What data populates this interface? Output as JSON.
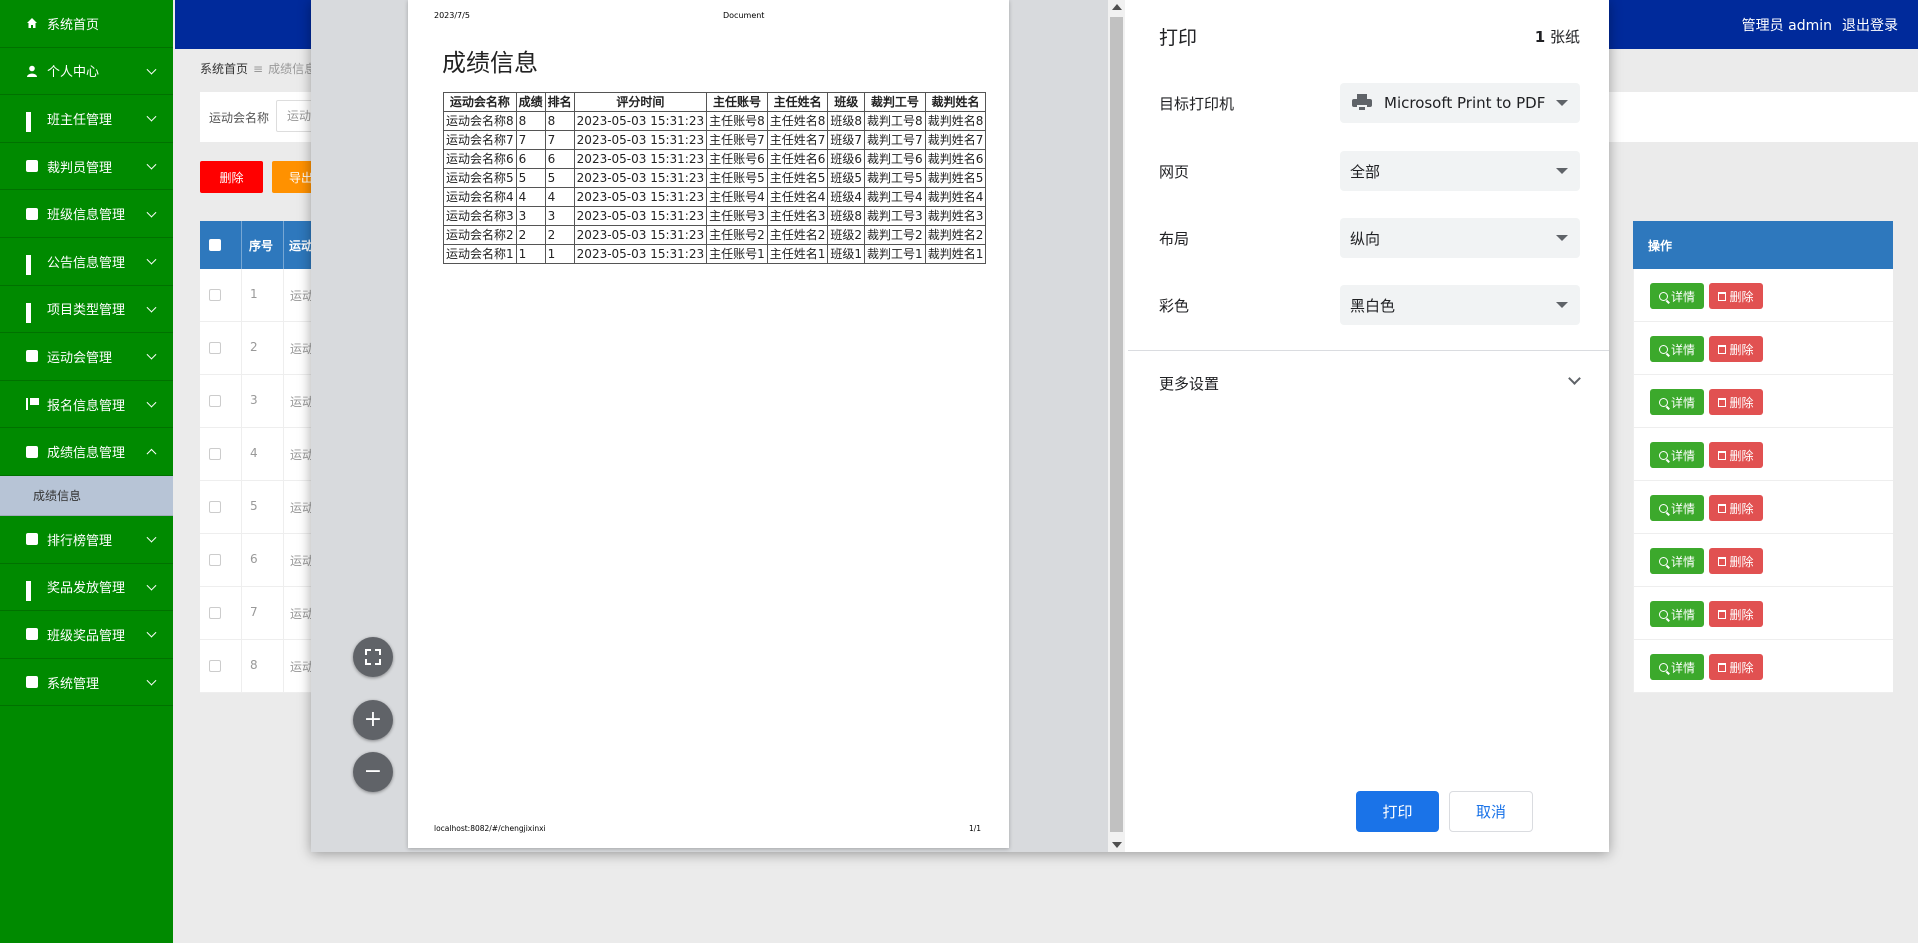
{
  "sidebar": {
    "items": [
      {
        "label": "系统首页",
        "icon": "home-icon",
        "chevron": false
      },
      {
        "label": "个人中心",
        "icon": "user-icon",
        "chevron": true
      },
      {
        "label": "班主任管理",
        "icon": "grid-icon",
        "chevron": true
      },
      {
        "label": "裁判员管理",
        "icon": "chat-icon",
        "chevron": true
      },
      {
        "label": "班级信息管理",
        "icon": "clipboard-icon",
        "chevron": true
      },
      {
        "label": "公告信息管理",
        "icon": "grid-icon",
        "chevron": true
      },
      {
        "label": "项目类型管理",
        "icon": "grid-icon",
        "chevron": true
      },
      {
        "label": "运动会管理",
        "icon": "chat-icon",
        "chevron": true
      },
      {
        "label": "报名信息管理",
        "icon": "flag-icon",
        "chevron": true
      },
      {
        "label": "成绩信息管理",
        "icon": "briefcase-icon",
        "chevron": true,
        "expanded": true
      }
    ],
    "submenu": {
      "label": "成绩信息"
    },
    "items_after": [
      {
        "label": "排行榜管理",
        "icon": "clipboard-icon"
      },
      {
        "label": "奖品发放管理",
        "icon": "grid-icon"
      },
      {
        "label": "班级奖品管理",
        "icon": "ticket-icon"
      },
      {
        "label": "系统管理",
        "icon": "chat-icon"
      }
    ]
  },
  "topbar": {
    "user": "管理员 admin",
    "logout": "退出登录"
  },
  "breadcrumb": {
    "home": "系统首页",
    "sep": "≡",
    "current": "成绩信息"
  },
  "search": {
    "label": "运动会名称",
    "placeholder": "运动"
  },
  "actions": {
    "delete": "删除",
    "export": "导出"
  },
  "table": {
    "headers": {
      "seq": "序号",
      "name_partial": "运动",
      "ops": "操作"
    },
    "rows": [
      {
        "seq": "1",
        "name_partial": "运动"
      },
      {
        "seq": "2",
        "name_partial": "运动"
      },
      {
        "seq": "3",
        "name_partial": "运动"
      },
      {
        "seq": "4",
        "name_partial": "运动"
      },
      {
        "seq": "5",
        "name_partial": "运动"
      },
      {
        "seq": "6",
        "name_partial": "运动"
      },
      {
        "seq": "7",
        "name_partial": "运动"
      },
      {
        "seq": "8",
        "name_partial": "运动"
      }
    ],
    "detail_label": "详情",
    "remove_label": "删除"
  },
  "print_preview": {
    "date": "2023/7/5",
    "doc_title": "Document",
    "heading": "成绩信息",
    "columns": [
      "运动会名称",
      "成绩",
      "排名",
      "评分时间",
      "主任账号",
      "主任姓名",
      "班级",
      "裁判工号",
      "裁判姓名"
    ],
    "rows": [
      [
        "运动会名称8",
        "8",
        "8",
        "2023-05-03 15:31:23",
        "主任账号8",
        "主任姓名8",
        "班级8",
        "裁判工号8",
        "裁判姓名8"
      ],
      [
        "运动会名称7",
        "7",
        "7",
        "2023-05-03 15:31:23",
        "主任账号7",
        "主任姓名7",
        "班级7",
        "裁判工号7",
        "裁判姓名7"
      ],
      [
        "运动会名称6",
        "6",
        "6",
        "2023-05-03 15:31:23",
        "主任账号6",
        "主任姓名6",
        "班级6",
        "裁判工号6",
        "裁判姓名6"
      ],
      [
        "运动会名称5",
        "5",
        "5",
        "2023-05-03 15:31:23",
        "主任账号5",
        "主任姓名5",
        "班级5",
        "裁判工号5",
        "裁判姓名5"
      ],
      [
        "运动会名称4",
        "4",
        "4",
        "2023-05-03 15:31:23",
        "主任账号4",
        "主任姓名4",
        "班级4",
        "裁判工号4",
        "裁判姓名4"
      ],
      [
        "运动会名称3",
        "3",
        "3",
        "2023-05-03 15:31:23",
        "主任账号3",
        "主任姓名3",
        "班级8",
        "裁判工号3",
        "裁判姓名3"
      ],
      [
        "运动会名称2",
        "2",
        "2",
        "2023-05-03 15:31:23",
        "主任账号2",
        "主任姓名2",
        "班级2",
        "裁判工号2",
        "裁判姓名2"
      ],
      [
        "运动会名称1",
        "1",
        "1",
        "2023-05-03 15:31:23",
        "主任账号1",
        "主任姓名1",
        "班级1",
        "裁判工号1",
        "裁判姓名1"
      ]
    ],
    "url": "localhost:8082/#/chengjixinxi",
    "page": "1/1"
  },
  "print_settings": {
    "title": "打印",
    "sheet_count": "1",
    "sheet_unit": "张纸",
    "destination_label": "目标打印机",
    "destination_value": "Microsoft Print to PDF",
    "pages_label": "网页",
    "pages_value": "全部",
    "layout_label": "布局",
    "layout_value": "纵向",
    "color_label": "彩色",
    "color_value": "黑白色",
    "more_settings": "更多设置",
    "print_button": "打印",
    "cancel_button": "取消"
  },
  "zoom": {
    "plus": "+",
    "minus": "−"
  }
}
